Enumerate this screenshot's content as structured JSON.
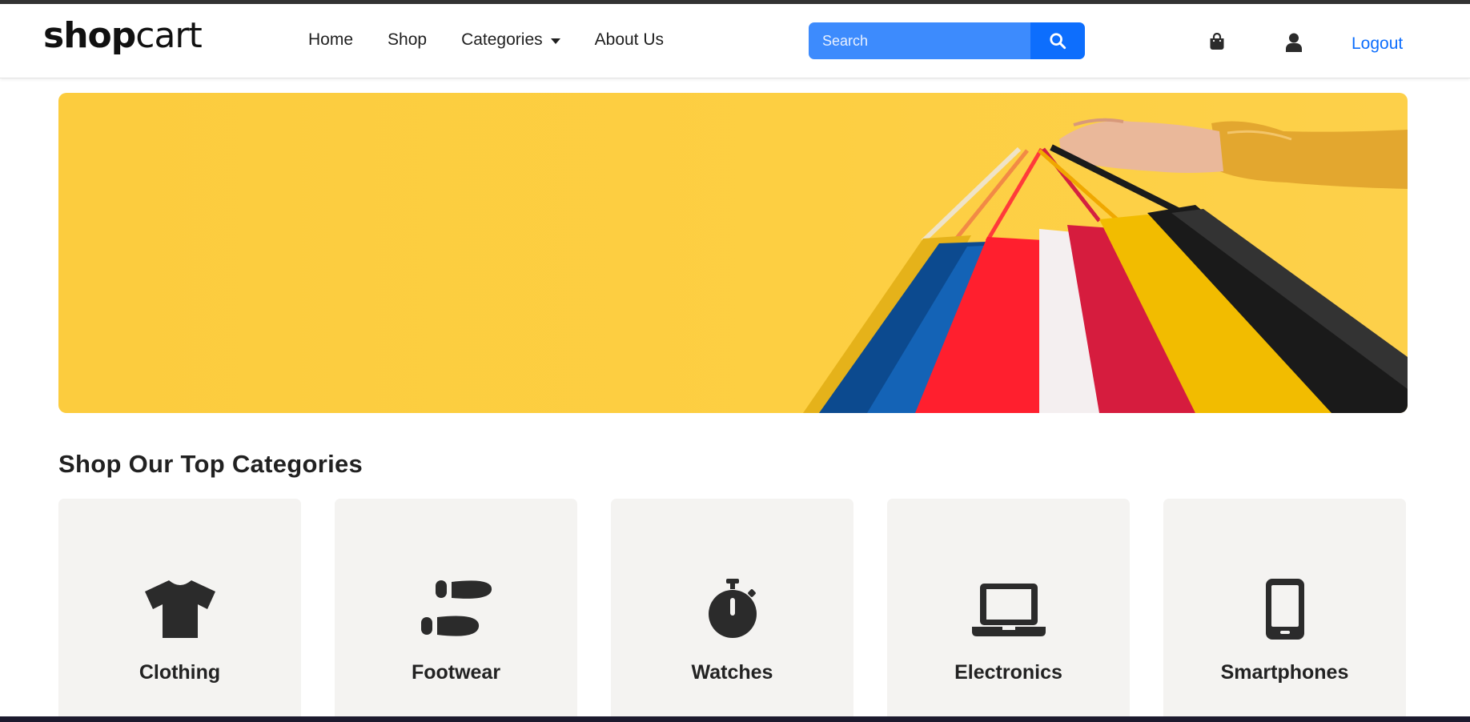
{
  "colors": {
    "accent": "#0d6efd",
    "search_bg": "#3d8bfd",
    "banner_bg": "#fdcd42",
    "card_bg": "#f4f3f1",
    "icon": "#2b2b2b"
  },
  "brand": {
    "part1": "shop",
    "part2": "cart"
  },
  "nav": {
    "links": [
      {
        "label": "Home"
      },
      {
        "label": "Shop"
      },
      {
        "label": "Categories",
        "has_dropdown": true
      },
      {
        "label": "About Us"
      }
    ]
  },
  "search": {
    "placeholder": "Search",
    "value": "",
    "icon": "search-icon"
  },
  "actions": {
    "cart_icon": "shopping-bag-icon",
    "user_icon": "user-icon",
    "logout_label": "Logout"
  },
  "banner": {
    "image": "hand holding colorful shopping bags on yellow background"
  },
  "categories_section": {
    "title": "Shop Our Top Categories",
    "items": [
      {
        "label": "Clothing",
        "icon": "tshirt-icon"
      },
      {
        "label": "Footwear",
        "icon": "shoe-prints-icon"
      },
      {
        "label": "Watches",
        "icon": "stopwatch-icon"
      },
      {
        "label": "Electronics",
        "icon": "laptop-icon"
      },
      {
        "label": "Smartphones",
        "icon": "mobile-phone-icon"
      }
    ]
  }
}
